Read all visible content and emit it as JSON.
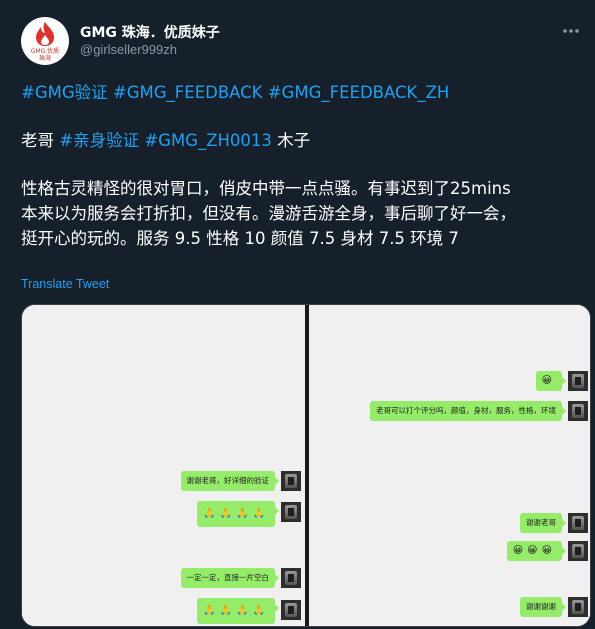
{
  "author": {
    "display_name": "GMG 珠海．优质妹子",
    "handle": "@girlseller999zh",
    "avatar_text_line1": "GMG.优质",
    "avatar_text_line2": "珠海"
  },
  "tweet": {
    "hashtags_line": [
      {
        "text": "#GMG验证",
        "tag": true
      },
      {
        "text": " ",
        "tag": false
      },
      {
        "text": "#GMG_FEEDBACK",
        "tag": true
      },
      {
        "text": " ",
        "tag": false
      },
      {
        "text": "#GMG_FEEDBACK_ZH",
        "tag": true
      }
    ],
    "line2_prefix": "老哥 ",
    "line2_tag1": "#亲身验证",
    "line2_sep": " ",
    "line2_tag2": "#GMG_ZH0013",
    "line2_suffix": " 木子",
    "body_lines": [
      "性格古灵精怪的很对胃口，俏皮中带一点点骚。有事迟到了25mins",
      "本来以为服务会打折扣，但没有。漫游舌游全身，事后聊了好一会，",
      "挺开心的玩的。服务 9.5 性格 10 颜值 7.5 身材 7.5 环境 7"
    ],
    "translate_label": "Translate Tweet"
  },
  "chat_left": [
    {
      "text": "谢谢老哥，好详细的验证",
      "emoji": false
    },
    {
      "text": "🙏🙏🙏🙏",
      "emoji": true
    },
    {
      "text": "一定一定，直接一片空白",
      "emoji": false
    },
    {
      "text": "🙏🙏🙏🙏",
      "emoji": true
    }
  ],
  "chat_right": [
    {
      "text": "😀",
      "emoji": true
    },
    {
      "text": "老哥可以打个评分吗，颜值，身材，服务，性格，环境",
      "emoji": false
    },
    {
      "text": "谢谢老哥",
      "emoji": false
    },
    {
      "text": "😀😀😀",
      "emoji": true
    },
    {
      "text": "谢谢谢谢",
      "emoji": false
    }
  ],
  "colors": {
    "background": "#15202b",
    "link": "#1da1f2",
    "muted": "#8899a6",
    "bubble": "#95ec69"
  },
  "icons": {
    "more": "more-horizontal-icon",
    "logo": "flame-logo-icon"
  }
}
